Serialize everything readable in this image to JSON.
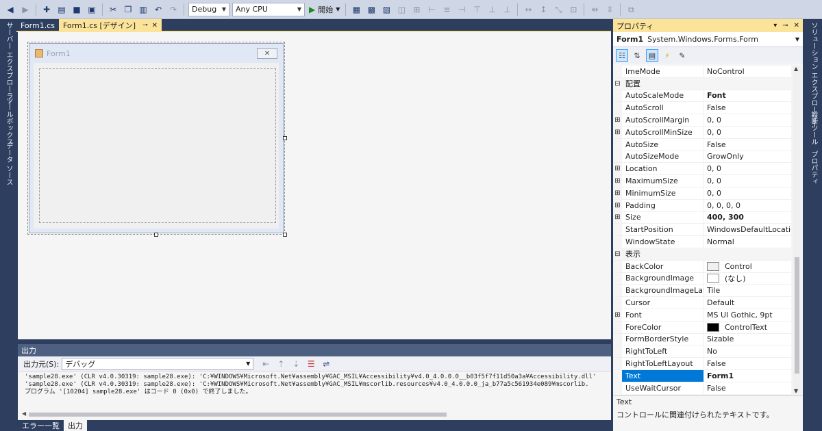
{
  "toolbar": {
    "config": "Debug",
    "platform": "Any CPU",
    "start": "開始"
  },
  "left_strip": {
    "server_explorer": "サーバー エクスプローラー",
    "toolbox": "ツールボックス",
    "datasource": "データ ソース"
  },
  "right_strip": {
    "solution_explorer": "ソリューション エクスプローラー",
    "diagnostics": "診断ツール",
    "properties": "プロパティ"
  },
  "doc_tabs": [
    {
      "label": "Form1.cs"
    },
    {
      "label": "Form1.cs [デザイン]"
    }
  ],
  "designer": {
    "form_title": "Form1"
  },
  "output": {
    "title": "出力",
    "source_label": "出力元(S):",
    "source_value": "デバッグ",
    "lines": [
      "'sample28.exe' (CLR v4.0.30319: sample28.exe): 'C:¥WINDOWS¥Microsoft.Net¥assembly¥GAC_MSIL¥Accessibility¥v4.0_4.0.0.0__b03f5f7f11d50a3a¥Accessibility.dll'",
      "'sample28.exe' (CLR v4.0.30319: sample28.exe): 'C:¥WINDOWS¥Microsoft.Net¥assembly¥GAC_MSIL¥mscorlib.resources¥v4.0_4.0.0.0_ja_b77a5c561934e089¥mscorlib.",
      "プログラム '[10204] sample28.exe' はコード 0 (0x0) で終了しました。"
    ]
  },
  "bottom_tabs": [
    "エラー一覧",
    "出力"
  ],
  "properties": {
    "title": "プロパティ",
    "object_name": "Form1",
    "object_type": "System.Windows.Forms.Form",
    "rows": [
      {
        "kind": "prop",
        "name": "ImeMode",
        "value": "NoControl",
        "expand": ""
      },
      {
        "kind": "cat",
        "name": "配置",
        "expand": "⊟"
      },
      {
        "kind": "prop",
        "name": "AutoScaleMode",
        "value": "Font",
        "expand": "",
        "bold": true
      },
      {
        "kind": "prop",
        "name": "AutoScroll",
        "value": "False",
        "expand": ""
      },
      {
        "kind": "prop",
        "name": "AutoScrollMargin",
        "value": "0, 0",
        "expand": "⊞"
      },
      {
        "kind": "prop",
        "name": "AutoScrollMinSize",
        "value": "0, 0",
        "expand": "⊞"
      },
      {
        "kind": "prop",
        "name": "AutoSize",
        "value": "False",
        "expand": ""
      },
      {
        "kind": "prop",
        "name": "AutoSizeMode",
        "value": "GrowOnly",
        "expand": ""
      },
      {
        "kind": "prop",
        "name": "Location",
        "value": "0, 0",
        "expand": "⊞"
      },
      {
        "kind": "prop",
        "name": "MaximumSize",
        "value": "0, 0",
        "expand": "⊞"
      },
      {
        "kind": "prop",
        "name": "MinimumSize",
        "value": "0, 0",
        "expand": "⊞"
      },
      {
        "kind": "prop",
        "name": "Padding",
        "value": "0, 0, 0, 0",
        "expand": "⊞"
      },
      {
        "kind": "prop",
        "name": "Size",
        "value": "400, 300",
        "expand": "⊞",
        "bold": true
      },
      {
        "kind": "prop",
        "name": "StartPosition",
        "value": "WindowsDefaultLocation",
        "expand": ""
      },
      {
        "kind": "prop",
        "name": "WindowState",
        "value": "Normal",
        "expand": ""
      },
      {
        "kind": "cat",
        "name": "表示",
        "expand": "⊟"
      },
      {
        "kind": "prop",
        "name": "BackColor",
        "value": "Control",
        "expand": "",
        "swatch": "#f0f0f0"
      },
      {
        "kind": "prop",
        "name": "BackgroundImage",
        "value": "(なし)",
        "expand": "",
        "swatch": "#ffffff"
      },
      {
        "kind": "prop",
        "name": "BackgroundImageLayout",
        "value": "Tile",
        "expand": ""
      },
      {
        "kind": "prop",
        "name": "Cursor",
        "value": "Default",
        "expand": ""
      },
      {
        "kind": "prop",
        "name": "Font",
        "value": "MS UI Gothic, 9pt",
        "expand": "⊞"
      },
      {
        "kind": "prop",
        "name": "ForeColor",
        "value": "ControlText",
        "expand": "",
        "swatch": "#000000"
      },
      {
        "kind": "prop",
        "name": "FormBorderStyle",
        "value": "Sizable",
        "expand": ""
      },
      {
        "kind": "prop",
        "name": "RightToLeft",
        "value": "No",
        "expand": ""
      },
      {
        "kind": "prop",
        "name": "RightToLeftLayout",
        "value": "False",
        "expand": ""
      },
      {
        "kind": "prop",
        "name": "Text",
        "value": "Form1",
        "expand": "",
        "bold": true,
        "selected": true
      },
      {
        "kind": "prop",
        "name": "UseWaitCursor",
        "value": "False",
        "expand": ""
      }
    ],
    "desc_title": "Text",
    "desc_body": "コントロールに関連付けられたテキストです。"
  },
  "colors": {
    "accent_tab": "#fbe39a",
    "frame": "#2d3e5f",
    "selection": "#0078d7"
  }
}
